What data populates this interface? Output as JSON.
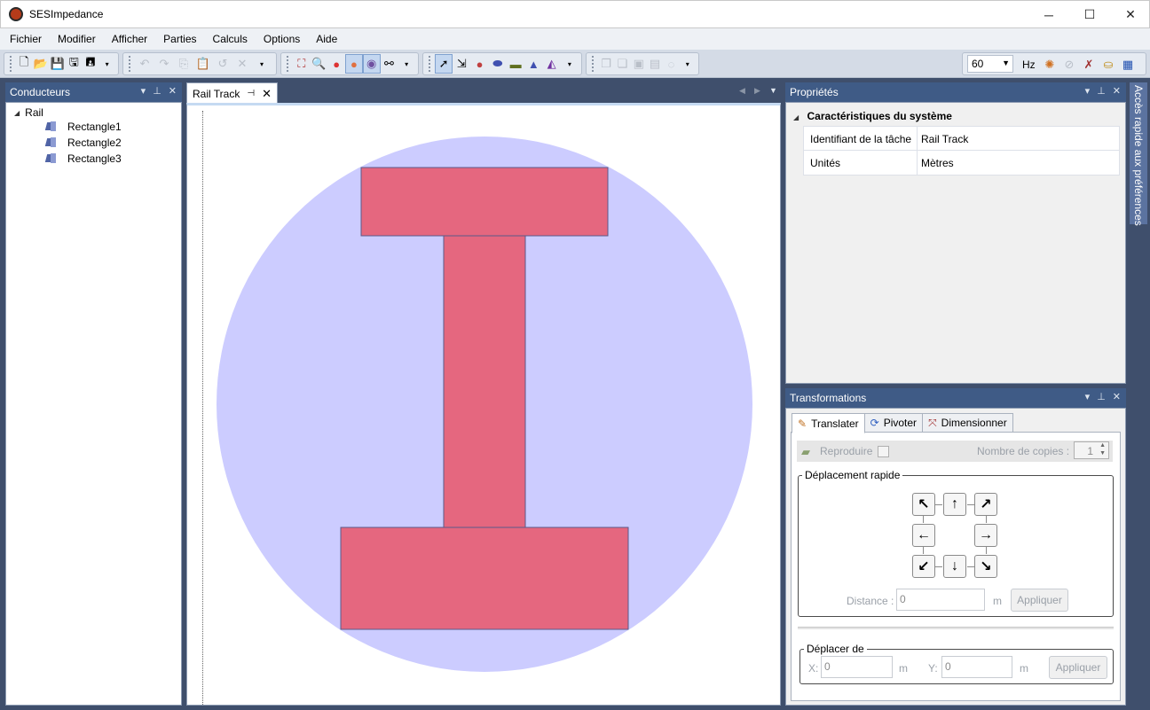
{
  "window": {
    "title": "SESImpedance",
    "minimize": "─",
    "maximize": "☐",
    "close": "✕"
  },
  "menu": [
    "Fichier",
    "Modifier",
    "Afficher",
    "Parties",
    "Calculs",
    "Options",
    "Aide"
  ],
  "toolbar": {
    "frequency": "60",
    "frequency_unit": "Hz"
  },
  "conducteurs": {
    "title": "Conducteurs",
    "root": "Rail",
    "children": [
      "Rectangle1",
      "Rectangle2",
      "Rectangle3"
    ]
  },
  "document": {
    "tab_label": "Rail Track"
  },
  "proprietes": {
    "title": "Propriétés",
    "category": "Caractéristiques du système",
    "rows": [
      {
        "key": "Identifiant de la tâche",
        "value": "Rail Track"
      },
      {
        "key": "Unités",
        "value": "Mètres"
      }
    ]
  },
  "transformations": {
    "title": "Transformations",
    "tabs": [
      "Translater",
      "Pivoter",
      "Dimensionner"
    ],
    "reproduire_label": "Reproduire",
    "nombre_copies_label": "Nombre de copies :",
    "nombre_copies_value": "1",
    "deplacement_rapide_legend": "Déplacement rapide",
    "arrows": {
      "nw": "↖",
      "n": "↑",
      "ne": "↗",
      "w": "←",
      "e": "→",
      "sw": "↙",
      "s": "↓",
      "se": "↘"
    },
    "distance_label": "Distance :",
    "distance_value": "0",
    "distance_unit": "m",
    "appliquer_label": "Appliquer",
    "deplacer_de_legend": "Déplacer de",
    "x_label": "X:",
    "x_value": "0",
    "x_unit": "m",
    "y_label": "Y:",
    "y_value": "0",
    "y_unit": "m",
    "appliquer2_label": "Appliquer"
  },
  "side_rail": {
    "label": "Accès rapide aux préférences"
  },
  "colors": {
    "panel_header": "#3f5b86",
    "circle_fill": "#ccccff",
    "rect_fill": "#e5677f",
    "rect_stroke": "#5a5a8a"
  }
}
